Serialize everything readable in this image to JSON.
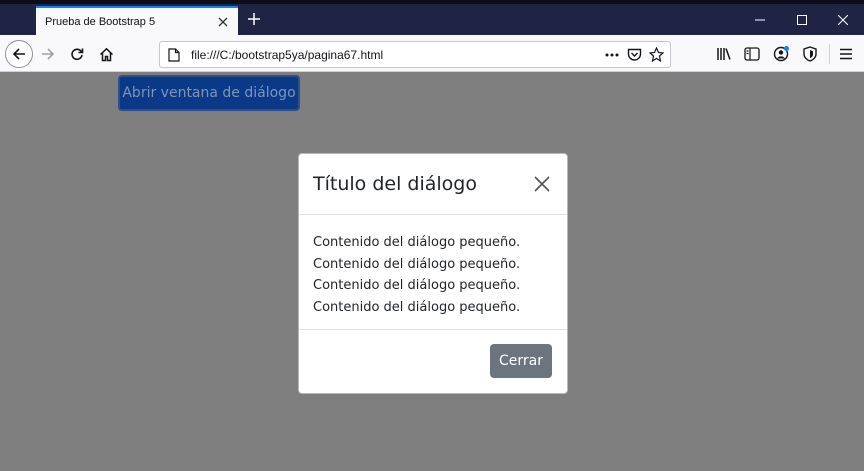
{
  "browser": {
    "tab_title": "Prueba de Bootstrap 5",
    "url": "file:///C:/bootstrap5ya/pagina67.html",
    "accent": "#0a84ff"
  },
  "page": {
    "open_button_label": "Abrir ventana de diálogo"
  },
  "modal": {
    "title": "Título del diálogo",
    "lines": [
      "Contenido del diálogo pequeño.",
      "Contenido del diálogo pequeño.",
      "Contenido del diálogo pequeño.",
      "Contenido del diálogo pequeño."
    ],
    "close_button_label": "Cerrar"
  }
}
